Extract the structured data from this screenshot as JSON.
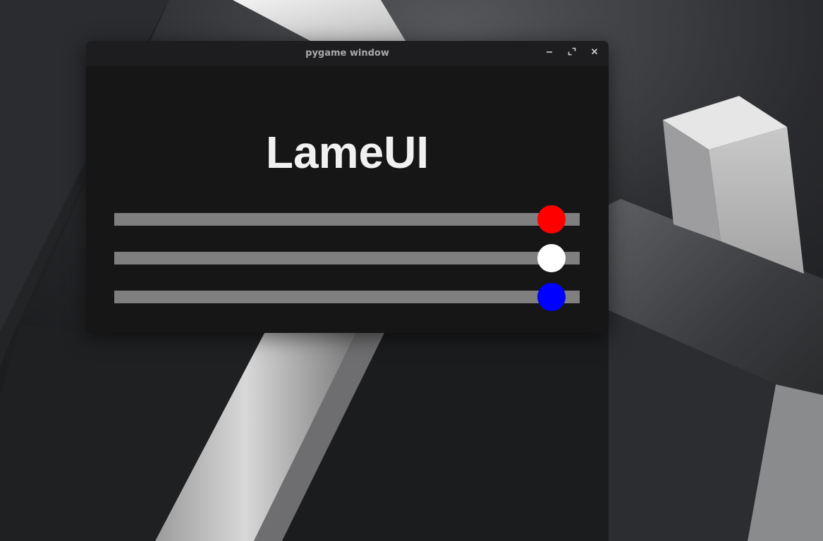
{
  "window": {
    "title": "pygame window",
    "controls": {
      "minimize_icon": "minimize-icon",
      "maximize_icon": "maximize-icon",
      "close_icon": "close-icon"
    }
  },
  "app": {
    "heading": "LameUI",
    "sliders": [
      {
        "color": "#ff0000",
        "value": 0.94
      },
      {
        "color": "#ffffff",
        "value": 0.94
      },
      {
        "color": "#0000ff",
        "value": 0.94
      }
    ]
  },
  "theme": {
    "window_bg": "#161617",
    "titlebar_bg": "#1d1d1f",
    "track_color": "#7f7f7f",
    "heading_color": "#f1f1f1"
  }
}
